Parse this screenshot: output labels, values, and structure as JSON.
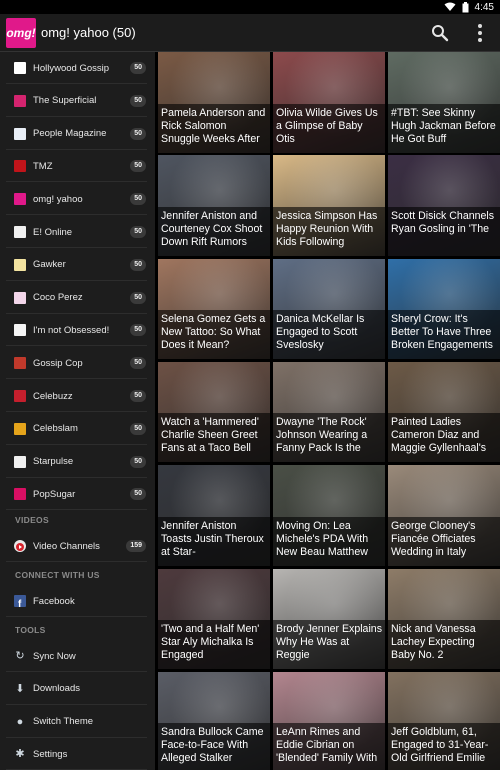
{
  "status_bar": {
    "time": "4:45"
  },
  "action_bar": {
    "logo_text": "omg!",
    "title": "omg! yahoo (50)"
  },
  "drawer": {
    "sources": [
      {
        "label": "Hollywood Gossip",
        "count": "50",
        "color": "#ffffff"
      },
      {
        "label": "The Superficial",
        "count": "50",
        "color": "#d4246f"
      },
      {
        "label": "People Magazine",
        "count": "50",
        "color": "#e9eef6"
      },
      {
        "label": "TMZ",
        "count": "50",
        "color": "#c0141a"
      },
      {
        "label": "omg! yahoo",
        "count": "50",
        "color": "#e0198a"
      },
      {
        "label": "E! Online",
        "count": "50",
        "color": "#f0f0f0"
      },
      {
        "label": "Gawker",
        "count": "50",
        "color": "#f3e3a0"
      },
      {
        "label": "Coco Perez",
        "count": "50",
        "color": "#f3d6ea"
      },
      {
        "label": "I'm not Obsessed!",
        "count": "50",
        "color": "#f6f6f6"
      },
      {
        "label": "Gossip Cop",
        "count": "50",
        "color": "#c0392b"
      },
      {
        "label": "Celebuzz",
        "count": "50",
        "color": "#c51f2d"
      },
      {
        "label": "Celebslam",
        "count": "50",
        "color": "#e5a41b"
      },
      {
        "label": "Starpulse",
        "count": "50",
        "color": "#f0f0f0"
      },
      {
        "label": "PopSugar",
        "count": "50",
        "color": "#d90f63"
      }
    ],
    "videos_header": "VIDEOS",
    "video_channels": {
      "label": "Video Channels",
      "count": "159"
    },
    "connect_header": "CONNECT WITH US",
    "facebook": {
      "label": "Facebook"
    },
    "tools_header": "TOOLS",
    "tools": [
      {
        "label": "Sync Now",
        "icon": "sync-icon"
      },
      {
        "label": "Downloads",
        "icon": "download-icon"
      },
      {
        "label": "Switch Theme",
        "icon": "theme-icon"
      },
      {
        "label": "Settings",
        "icon": "settings-icon"
      }
    ]
  },
  "articles": [
    {
      "title": "Pamela Anderson and Rick Salomon Snuggle Weeks After",
      "color": "#7b5a45"
    },
    {
      "title": "Olivia Wilde Gives Us a Glimpse of Baby Otis",
      "color": "#8d4a4c"
    },
    {
      "title": "#TBT: See Skinny Hugh Jackman Before He Got Buff",
      "color": "#5f6b62"
    },
    {
      "title": "Jennifer Aniston and Courteney Cox Shoot Down Rift Rumors",
      "color": "#4f5560"
    },
    {
      "title": "Jessica Simpson Has Happy Reunion With Kids Following",
      "color": "#d9b987"
    },
    {
      "title": "Scott Disick Channels Ryan Gosling in 'The",
      "color": "#3b2e44"
    },
    {
      "title": "Selena Gomez Gets a New Tattoo: So What Does it Mean?",
      "color": "#a0765f"
    },
    {
      "title": "Danica McKellar Is Engaged to Scott Sveslosky",
      "color": "#5f6e85"
    },
    {
      "title": "Sheryl Crow: It's Better To Have Three Broken Engagements",
      "color": "#2f6fa8"
    },
    {
      "title": "Watch a 'Hammered' Charlie Sheen Greet Fans at a Taco Bell",
      "color": "#6d5145"
    },
    {
      "title": "Dwayne 'The Rock' Johnson Wearing a Fanny Pack Is the",
      "color": "#7f7167"
    },
    {
      "title": "Painted Ladies Cameron Diaz and Maggie Gyllenhaal's",
      "color": "#6d5a47"
    },
    {
      "title": "Jennifer Aniston Toasts Justin Theroux at Star-",
      "color": "#35383f"
    },
    {
      "title": "Moving On: Lea Michele's PDA With New Beau Matthew",
      "color": "#4a4f46"
    },
    {
      "title": "George Clooney's Fiancée Officiates Wedding in Italy",
      "color": "#9a8a7a"
    },
    {
      "title": "'Two and a Half Men' Star Aly Michalka Is Engaged",
      "color": "#4e3a3d"
    },
    {
      "title": "Brody Jenner Explains Why He Was at Reggie",
      "color": "#b7b5b2"
    },
    {
      "title": "Nick and Vanessa Lachey Expecting Baby No. 2",
      "color": "#8e7c68"
    },
    {
      "title": "Sandra Bullock Came Face-to-Face With Alleged Stalker",
      "color": "#5a5d66"
    },
    {
      "title": "LeAnn Rimes and Eddie Cibrian on 'Blended' Family With",
      "color": "#b3868f"
    },
    {
      "title": "Jeff Goldblum, 61, Engaged to 31-Year-Old Girlfriend Emilie",
      "color": "#82715f"
    }
  ]
}
